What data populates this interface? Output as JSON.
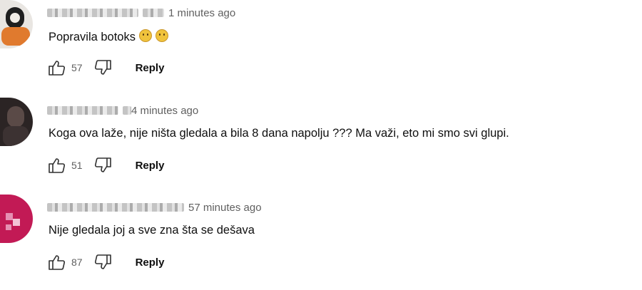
{
  "comments": [
    {
      "author_blurred": "",
      "time": "1 minutes ago",
      "text": "Popravila botoks",
      "emojis": [
        "crying-face",
        "crying-face"
      ],
      "likes": "57",
      "reply_label": "Reply"
    },
    {
      "author_blurred": "",
      "time": "4 minutes ago",
      "text": "Koga ova laže, nije ništa gledala  a bila 8 dana napolju ??? Ma važi, eto mi smo svi glupi.",
      "emojis": [],
      "likes": "51",
      "reply_label": "Reply"
    },
    {
      "author_blurred": "",
      "time": "57 minutes ago",
      "text": "Nije gledala joj a sve zna šta se dešava",
      "emojis": [],
      "likes": "87",
      "reply_label": "Reply"
    }
  ],
  "colors": {
    "text": "#0f0f0f",
    "meta": "#606060",
    "avatar3": "#c21a55"
  }
}
